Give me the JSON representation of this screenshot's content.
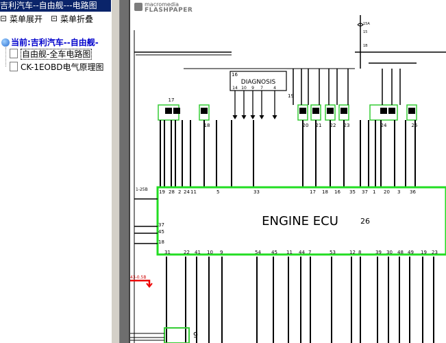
{
  "window": {
    "title": "吉利汽车--自由舰---电路图"
  },
  "menu": {
    "expand_label": "菜单展开",
    "collapse_label": "菜单折叠"
  },
  "tree": {
    "root_label": "当前:吉利汽车--自由舰-",
    "items": [
      {
        "label": "自由舰-全车电路图",
        "selected": true
      },
      {
        "label": "CK-1EOBD电气原理图",
        "selected": false
      }
    ]
  },
  "viewer": {
    "brand_small": "macromedia",
    "brand_big": "FLASHPAPER"
  },
  "diagram": {
    "ecu_label": "ENGINE ECU",
    "ecu_number": "26",
    "diagnosis_label": "DIAGNOSIS",
    "diagnosis_number": "16",
    "diagnosis_pins": [
      "14",
      "10",
      "9",
      "7",
      "4"
    ],
    "diagnosis_side_pin": "19",
    "connectors": [
      "17",
      "18",
      "20",
      "21",
      "22",
      "23",
      "24",
      "25"
    ],
    "ecu_top_pins": [
      "19",
      "28",
      "2",
      "24",
      "11",
      "5",
      "33",
      "17",
      "18",
      "16",
      "35",
      "37",
      "1",
      "20",
      "3",
      "36"
    ],
    "ecu_left_pins": [
      "37",
      "45",
      "18"
    ],
    "ecu_bottom_pins": [
      "31",
      "22",
      "41",
      "10",
      "9",
      "54",
      "45",
      "11",
      "44",
      "7",
      "53",
      "12",
      "8",
      "39",
      "30",
      "48",
      "49",
      "19",
      "23"
    ],
    "side_labels": [
      "1-25B",
      "43-0.5B"
    ],
    "fuse_labels": [
      "15A",
      "15",
      "1B"
    ],
    "bottom_connector_number": "9"
  }
}
